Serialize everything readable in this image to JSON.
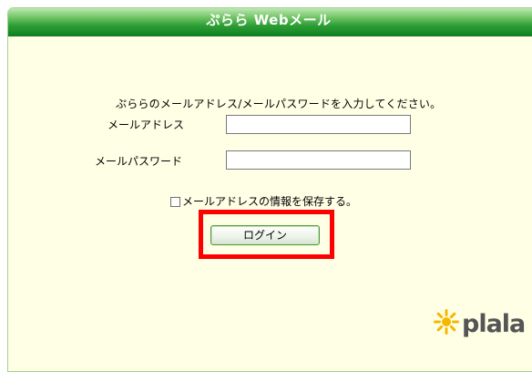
{
  "header": {
    "app_title": "ぷらら Webメール"
  },
  "form": {
    "instructions": "ぷららのメールアドレス/メールパスワードを入力してください。",
    "address_label": "メールアドレス",
    "address_value": "",
    "password_label": "メールパスワード",
    "password_value": "",
    "save_checkbox_label": "メールアドレスの情報を保存する。",
    "save_checked": false,
    "login_button_label": "ログイン"
  },
  "branding": {
    "logo_text": "plala",
    "logo_icon": "sun-icon",
    "logo_color": "#555555",
    "sun_color": "#f5b800"
  },
  "annotation": {
    "highlight_color": "#ff0000"
  },
  "colors": {
    "header_green": "#2c9d35",
    "background": "#ffffe6"
  }
}
